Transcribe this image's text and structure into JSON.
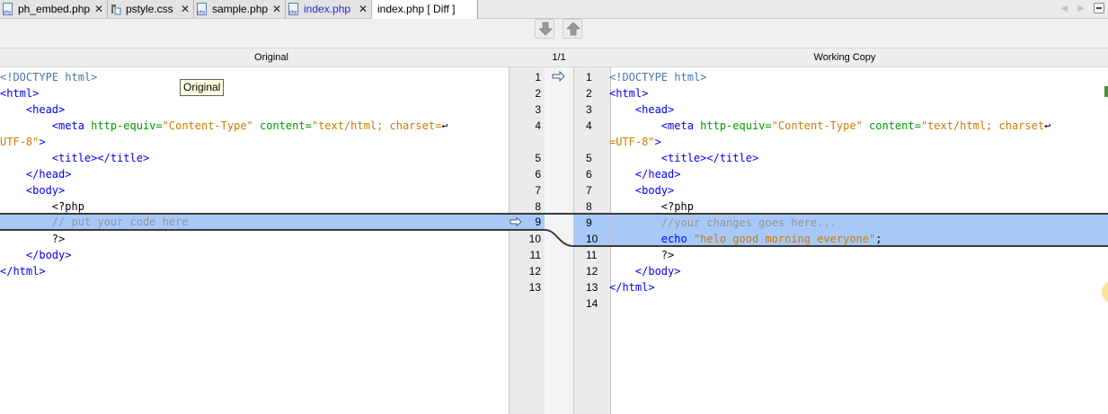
{
  "tabs": [
    {
      "label": "ph_embed.php",
      "icon": "php-file-icon"
    },
    {
      "label": "pstyle.css",
      "icon": "css-file-icon"
    },
    {
      "label": "sample.php",
      "icon": "php-file-icon"
    },
    {
      "label": "index.php",
      "icon": "php-file-icon"
    },
    {
      "label": "index.php [ Diff ]",
      "icon": "none"
    }
  ],
  "tab_close_glyph": "✕",
  "nav_arrows": "◀ ▶",
  "toolbar": {
    "next_diff": "down-arrow-icon",
    "prev_diff": "up-arrow-icon"
  },
  "headers": {
    "original": "Original",
    "diff_count": "1/1",
    "working": "Working Copy"
  },
  "tooltip": "Original",
  "colors": {
    "highlight": "#a8c8f8",
    "tag": "#0000e6",
    "attribute": "#009900",
    "string": "#ce7b00",
    "comment": "#969696"
  },
  "original": {
    "line_numbers": [
      "1",
      "2",
      "3",
      "4",
      "",
      "5",
      "6",
      "7",
      "8",
      "9",
      "10",
      "11",
      "12",
      "13"
    ],
    "lines": [
      "<!DOCTYPE html>",
      "<html>",
      "    <head>",
      "        <meta http-equiv=\"Content-Type\" content=\"text/html; charset=",
      "UTF-8\">",
      "        <title></title>",
      "    </head>",
      "    <body>",
      "        <?php",
      "        // put your code here",
      "        ?>",
      "    </body>",
      "</html>"
    ]
  },
  "working": {
    "line_numbers": [
      "1",
      "2",
      "3",
      "4",
      "",
      "5",
      "6",
      "7",
      "8",
      "9",
      "10",
      "11",
      "12",
      "13",
      "14"
    ],
    "lines": [
      "<!DOCTYPE html>",
      "<html>",
      "    <head>",
      "        <meta http-equiv=\"Content-Type\" content=\"text/html; charset",
      "=UTF-8\">",
      "        <title></title>",
      "    </head>",
      "    <body>",
      "        <?php",
      "        //your changes goes here...",
      "        echo \"helo good morning everyone\";",
      "        ?>",
      "    </body>",
      "</html>"
    ]
  },
  "wrap_glyph": "↩"
}
